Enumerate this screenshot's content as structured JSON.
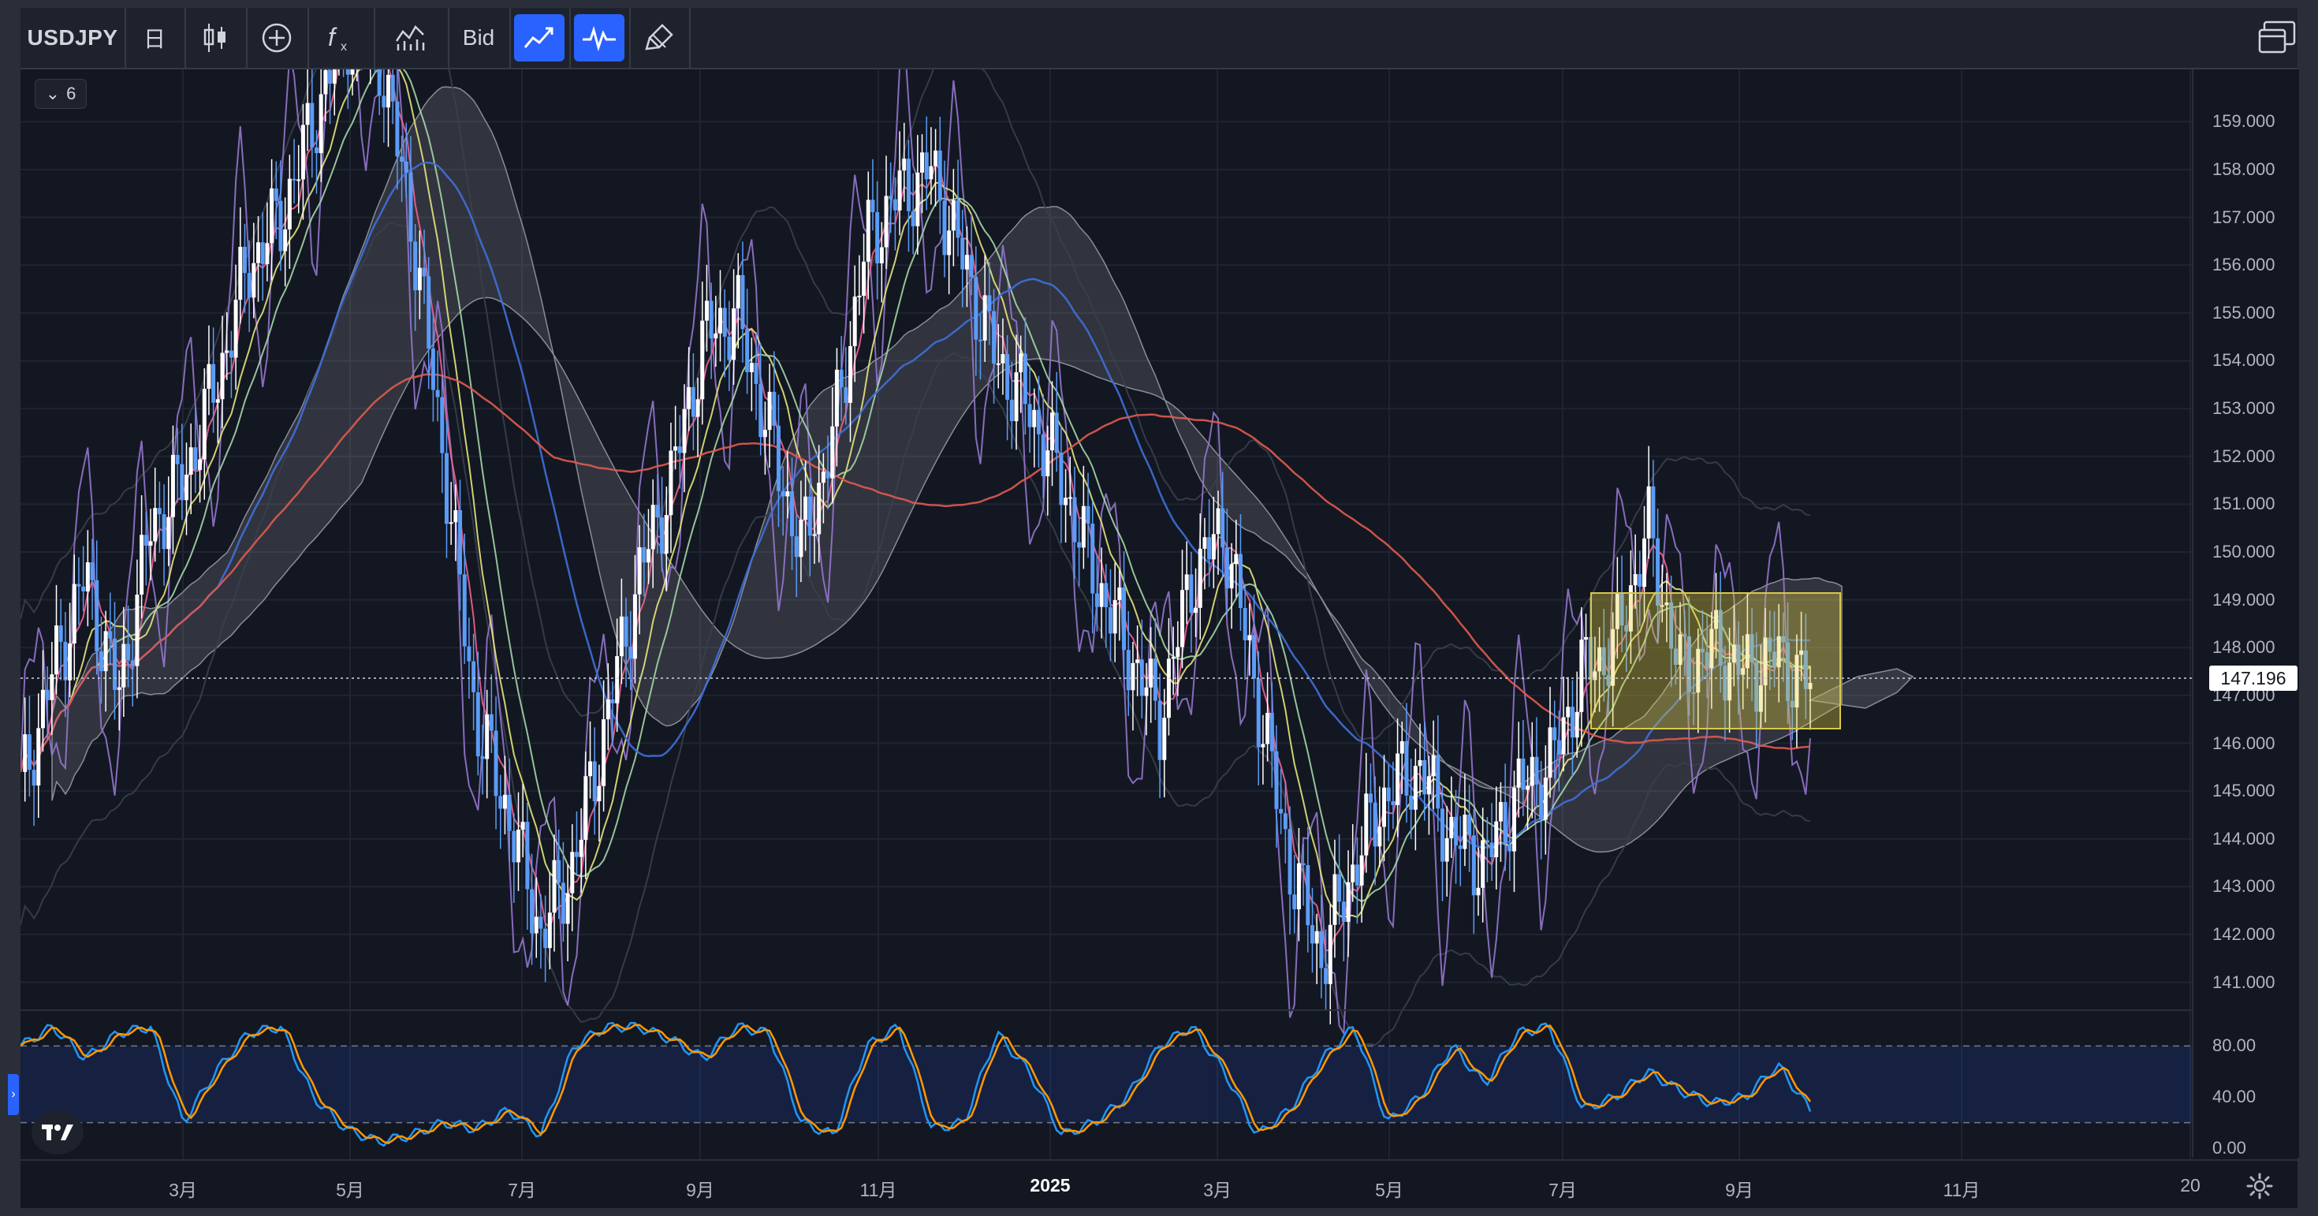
{
  "toolbar": {
    "symbol": "USDJPY",
    "interval": "日",
    "price_type": "Bid",
    "buttons": [
      {
        "name": "interval-button",
        "label": "日"
      },
      {
        "name": "chart-type-icon",
        "icon": "candles-icon"
      },
      {
        "name": "compare-icon",
        "icon": "plus-circle-icon"
      },
      {
        "name": "indicators-icon",
        "icon": "fx-icon"
      },
      {
        "name": "templates-icon",
        "icon": "chart-icon"
      },
      {
        "name": "bid-button",
        "label": "Bid"
      },
      {
        "name": "trend-icon",
        "icon": "line-chart-icon",
        "active": true
      },
      {
        "name": "pulse-icon",
        "icon": "pulse-icon",
        "active": true
      },
      {
        "name": "brush-icon",
        "icon": "brush-icon"
      }
    ]
  },
  "legend": {
    "collapse_glyph": "⌄",
    "count": "6"
  },
  "price_axis": {
    "ticks": [
      "159.000",
      "158.000",
      "157.000",
      "156.000",
      "155.000",
      "154.000",
      "153.000",
      "152.000",
      "151.000",
      "150.000",
      "149.000",
      "148.000",
      "147.000",
      "146.000",
      "145.000",
      "144.000",
      "143.000",
      "142.000",
      "141.000"
    ],
    "current_price": "147.196"
  },
  "oscillator_axis": {
    "ticks": [
      "80.00",
      "40.00",
      "0.00"
    ]
  },
  "time_axis": {
    "ticks": [
      {
        "label": "3月",
        "bold": false
      },
      {
        "label": "5月",
        "bold": false
      },
      {
        "label": "7月",
        "bold": false
      },
      {
        "label": "9月",
        "bold": false
      },
      {
        "label": "11月",
        "bold": false
      },
      {
        "label": "2025",
        "bold": true
      },
      {
        "label": "3月",
        "bold": false
      },
      {
        "label": "5月",
        "bold": false
      },
      {
        "label": "7月",
        "bold": false
      },
      {
        "label": "9月",
        "bold": false
      },
      {
        "label": "11月",
        "bold": false
      },
      {
        "label": "20",
        "bold": false
      }
    ]
  },
  "chart_data": {
    "type": "line",
    "symbol": "USDJPY",
    "interval": "日",
    "y_range": [
      140.5,
      159.5
    ],
    "current_price": 147.196,
    "months": [
      "3月",
      "5月",
      "7月",
      "9月",
      "11月",
      "2025",
      "3月",
      "5月",
      "7月",
      "9月",
      "11月"
    ],
    "close_series": [
      145.0,
      147.5,
      149.5,
      147.0,
      150.5,
      151.5,
      153.5,
      156.0,
      157.0,
      159.0,
      161.0,
      160.5,
      157.0,
      152.0,
      146.5,
      144.5,
      142.0,
      143.5,
      146.5,
      149.5,
      151.5,
      154.5,
      155.0,
      152.5,
      150.0,
      152.5,
      156.5,
      157.5,
      158.0,
      156.0,
      154.0,
      153.0,
      151.5,
      149.5,
      148.0,
      146.5,
      149.5,
      150.5,
      147.0,
      143.5,
      141.5,
      143.5,
      145.0,
      145.5,
      144.0,
      143.5,
      145.0,
      145.5,
      147.5,
      148.0,
      150.5,
      147.5,
      148.0,
      147.5,
      147.8,
      147.2
    ],
    "oscillator": {
      "name": "stochastic",
      "levels": [
        80,
        20
      ],
      "y_range": [
        0,
        100
      ],
      "k_values": [
        80,
        95,
        70,
        90,
        95,
        20,
        60,
        90,
        95,
        40,
        15,
        5,
        10,
        20,
        15,
        30,
        10,
        80,
        95,
        95,
        85,
        70,
        95,
        90,
        20,
        10,
        80,
        95,
        15,
        20,
        90,
        60,
        10,
        20,
        40,
        80,
        95,
        60,
        10,
        30,
        70,
        95,
        20,
        40,
        80,
        50,
        90,
        95,
        30,
        40,
        60,
        45,
        35,
        40,
        65,
        30
      ]
    }
  }
}
